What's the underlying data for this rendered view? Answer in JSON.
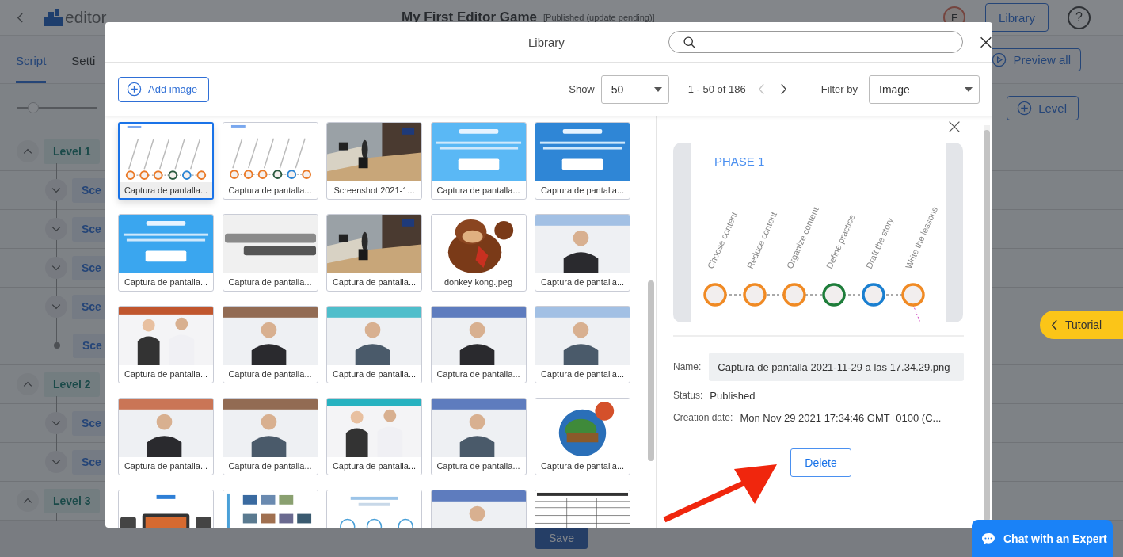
{
  "app_header": {
    "logo": "editor",
    "title": "My First Editor Game",
    "status": "[Published (update pending)]",
    "avatar": "F",
    "library_button": "Library",
    "help": "?"
  },
  "tabs": [
    {
      "label": "Script",
      "selected": true
    },
    {
      "label": "Setti",
      "selected": false
    }
  ],
  "preview_button": "Preview all",
  "zoom_slider": {
    "level": 0.2
  },
  "add_level_button": "Level",
  "levels": [
    {
      "label": "Level 1",
      "expanded": true,
      "children": [
        {
          "label": "Sce",
          "expandable": true,
          "expanded": false
        },
        {
          "label": "Sce",
          "expandable": true,
          "expanded": false
        },
        {
          "label": "Sce",
          "expandable": true,
          "expanded": false
        },
        {
          "label": "Sce",
          "expandable": true,
          "expanded": false
        },
        {
          "label": "Sce",
          "expandable": false
        }
      ]
    },
    {
      "label": "Level 2",
      "expanded": true,
      "children": [
        {
          "label": "Sce",
          "expandable": true,
          "expanded": false
        },
        {
          "label": "Sce",
          "expandable": true,
          "expanded": false
        }
      ]
    },
    {
      "label": "Level 3",
      "expanded": true
    }
  ],
  "save_button": "Save",
  "library": {
    "title": "Library",
    "add_button": "Add image",
    "show_label": "Show",
    "page_size": "50",
    "range": "1 - 50 of 186",
    "prev": {
      "disabled": true
    },
    "next": {
      "disabled": false
    },
    "filter_label": "Filter by",
    "filter_value": "Image",
    "items": [
      {
        "caption": "Captura de pantalla...",
        "selected": true
      },
      {
        "caption": "Captura de pantalla...",
        "selected": false
      },
      {
        "caption": "Screenshot 2021-1...",
        "selected": false
      },
      {
        "caption": "Captura de pantalla...",
        "selected": false
      },
      {
        "caption": "Captura de pantalla...",
        "selected": false
      },
      {
        "caption": "Captura de pantalla...",
        "selected": false
      },
      {
        "caption": "Captura de pantalla...",
        "selected": false
      },
      {
        "caption": "Captura de pantalla...",
        "selected": false
      },
      {
        "caption": "donkey kong.jpeg",
        "selected": false
      },
      {
        "caption": "Captura de pantalla...",
        "selected": false
      },
      {
        "caption": "Captura de pantalla...",
        "selected": false
      },
      {
        "caption": "Captura de pantalla...",
        "selected": false
      },
      {
        "caption": "Captura de pantalla...",
        "selected": false
      },
      {
        "caption": "Captura de pantalla...",
        "selected": false
      },
      {
        "caption": "Captura de pantalla...",
        "selected": false
      },
      {
        "caption": "Captura de pantalla...",
        "selected": false
      },
      {
        "caption": "Captura de pantalla...",
        "selected": false
      },
      {
        "caption": "Captura de pantalla...",
        "selected": false
      },
      {
        "caption": "Captura de pantalla...",
        "selected": false
      },
      {
        "caption": "Captura de pantalla...",
        "selected": false
      },
      {
        "selected": false
      },
      {
        "selected": false
      },
      {
        "selected": false
      },
      {
        "selected": false
      },
      {
        "selected": false
      }
    ],
    "details": {
      "preview": {
        "title": "PHASE 1",
        "steps": [
          {
            "label": "Choose content",
            "color": "#f08a24"
          },
          {
            "label": "Reduce content",
            "color": "#f08a24"
          },
          {
            "label": "Organize content",
            "color": "#f08a24"
          },
          {
            "label": "Define practice",
            "color": "#1e7d3a"
          },
          {
            "label": "Draft the story",
            "color": "#1a7fd0"
          },
          {
            "label": "Write the lessons",
            "color": "#f08a24"
          }
        ]
      },
      "fields": [
        {
          "kind": "field",
          "label": "Name:",
          "value": "Captura de pantalla 2021-11-29 a las 17.34.29.png"
        },
        {
          "kind": "text",
          "label": "Status:",
          "value": "Published"
        },
        {
          "kind": "text",
          "label": "Creation date:",
          "value": "Mon Nov 29 2021 17:34:46 GMT+0100 (C..."
        }
      ],
      "delete_button": "Delete"
    }
  },
  "tutorial_tab": "Tutorial",
  "chat_button": "Chat with an Expert"
}
